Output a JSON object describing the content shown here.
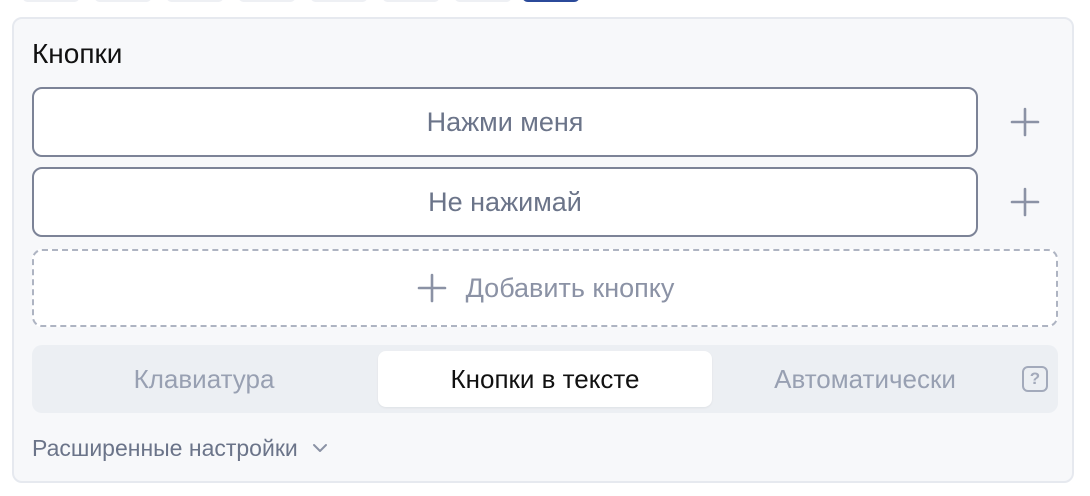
{
  "colors": {
    "card_background": "#f7f8fa",
    "border": "#7c8397",
    "dashed_border": "#aeb4c2",
    "muted_text": "#8b92a5",
    "active_tab_text": "#111111",
    "top_chip_accent": "#2b4a9a"
  },
  "section": {
    "title": "Кнопки"
  },
  "buttons": [
    {
      "label": "Нажми меня",
      "add_icon": "plus-icon"
    },
    {
      "label": "Не нажимай",
      "add_icon": "plus-icon"
    }
  ],
  "add_button": {
    "icon": "plus-icon",
    "label": "Добавить кнопку"
  },
  "layout_modes": {
    "options": [
      "Клавиатура",
      "Кнопки в тексте",
      "Автоматически"
    ],
    "selected": "Кнопки в тексте",
    "help_icon": "question-icon",
    "help_glyph": "?"
  },
  "advanced": {
    "label": "Расширенные настройки",
    "icon": "chevron-down-icon"
  }
}
